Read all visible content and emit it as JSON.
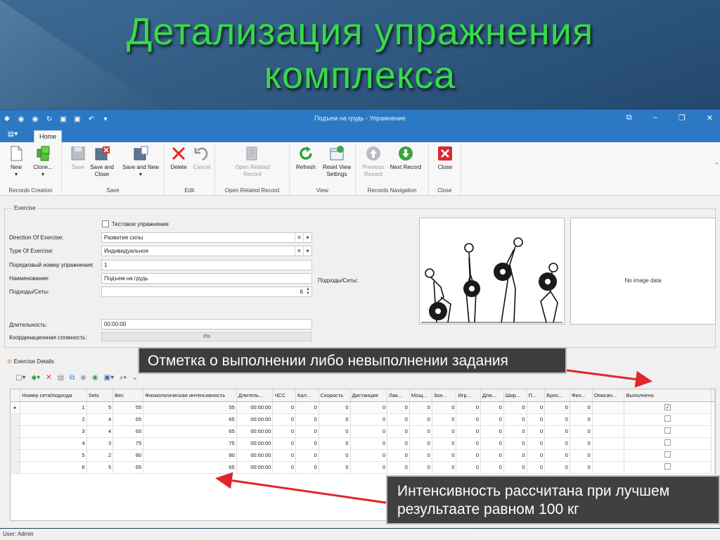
{
  "slide": {
    "title_line1": "Детализация упражнения",
    "title_line2": "комплекса"
  },
  "window": {
    "title": "Подъем на грудь - Упражнение",
    "qat_icons": [
      "gear-icon",
      "back-icon",
      "forward-icon",
      "refresh-icon",
      "save-icon",
      "save-close-icon",
      "undo-icon",
      "customize-icon"
    ]
  },
  "ribbon": {
    "home_tab": "Home",
    "groups": {
      "records_creation": "Records Creation",
      "save": "Save",
      "edit": "Edit",
      "open_related": "Open Related Record",
      "view": "View",
      "records_navigation": "Records Navigation",
      "close": "Close"
    },
    "buttons": {
      "new": "New",
      "clone": "Clone...",
      "save": "Save",
      "save_and_close": "Save and Close",
      "save_and_new": "Save and New",
      "delete": "Delete",
      "cancel": "Cancel",
      "open_related_record": "Open Related Record",
      "refresh": "Refresh",
      "reset_view_settings": "Reset View Settings",
      "previous_record": "Previous Record",
      "next_record": "Next Record",
      "close": "Close"
    }
  },
  "form": {
    "group_label": "Exercise",
    "test_exercise_label": "Тестовое упражнение",
    "direction_label": "Direction Of Exercise:",
    "direction_value": "Развитие силы",
    "type_label": "Type Of Exercise:",
    "type_value": "Индивидуальное",
    "order_label": "Порядковый номер упражнения:",
    "order_value": "1",
    "name_label": "Наименование:",
    "name_value": "Подъем на грудь",
    "sets_label": "Подходы/Сеты:",
    "sets_value": "6",
    "sets_side_label": "Подходы/Сеты:",
    "duration_label": "Длительность:",
    "duration_value": "00:00:00",
    "complexity_label": "Координационная сложность:",
    "complexity_value": "0%",
    "complexity_level": 0,
    "no_image": "No image data"
  },
  "details": {
    "label": "Exercise Details",
    "columns": [
      "Номер сета/подхода",
      "Sets",
      "Вес",
      "Физиологическая интенсивность",
      "Длитель...",
      "ЧСС",
      "Кал...",
      "Скорость",
      "Дистанция",
      "Лак...",
      "Мощ...",
      "Зон...",
      "Игр...",
      "Дли...",
      "Шир...",
      "П...",
      "Брос...",
      "Физ...",
      "Описан...",
      "Выполнено"
    ],
    "rows": [
      [
        "1",
        "5",
        "55",
        "55",
        "00:00:00",
        "0",
        "0",
        "0",
        "0",
        "0",
        "0",
        "0",
        "0",
        "0",
        "0",
        "0",
        "0",
        "0",
        "",
        "✓"
      ],
      [
        "2",
        "4",
        "65",
        "65",
        "00:00:00",
        "0",
        "0",
        "0",
        "0",
        "0",
        "0",
        "0",
        "0",
        "0",
        "0",
        "0",
        "0",
        "0",
        "",
        ""
      ],
      [
        "3",
        "4",
        "65",
        "65",
        "00:00:00",
        "0",
        "0",
        "0",
        "0",
        "0",
        "0",
        "0",
        "0",
        "0",
        "0",
        "0",
        "0",
        "0",
        "",
        ""
      ],
      [
        "4",
        "3",
        "75",
        "75",
        "00:00:00",
        "0",
        "0",
        "0",
        "0",
        "0",
        "0",
        "0",
        "0",
        "0",
        "0",
        "0",
        "0",
        "0",
        "",
        ""
      ],
      [
        "5",
        "2",
        "80",
        "80",
        "00:00:00",
        "0",
        "0",
        "0",
        "0",
        "0",
        "0",
        "0",
        "0",
        "0",
        "0",
        "0",
        "0",
        "0",
        "",
        ""
      ],
      [
        "6",
        "5",
        "65",
        "65",
        "00:00:00",
        "0",
        "0",
        "0",
        "0",
        "0",
        "0",
        "0",
        "0",
        "0",
        "0",
        "0",
        "0",
        "0",
        "",
        ""
      ]
    ]
  },
  "status": {
    "user": "User: Admin"
  },
  "callouts": {
    "completion_note": "Отметка о выполнении либо невыполнении задания",
    "intensity_note_line1": "Интенсивность рассчитана при лучшем",
    "intensity_note_line2": "результаате равном 100 кг"
  },
  "colors": {
    "title_green": "#39d94a",
    "ribbon_blue": "#2b79c4",
    "arrow_red": "#e0262a"
  }
}
